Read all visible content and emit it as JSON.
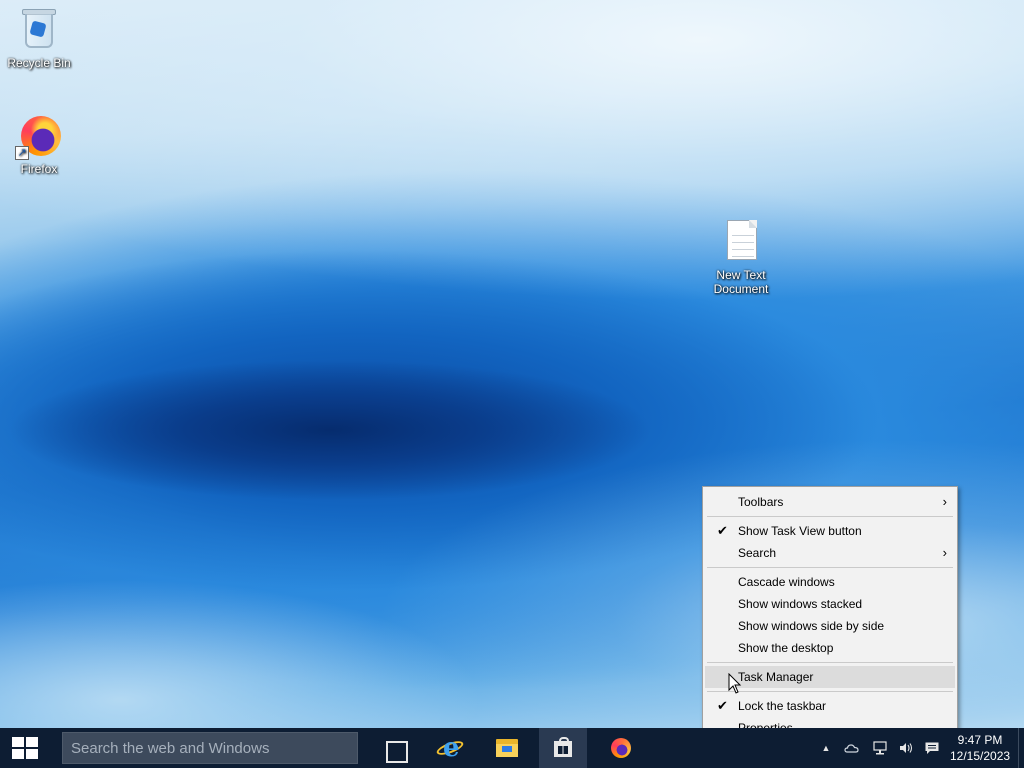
{
  "desktop": {
    "icons": [
      {
        "label": "Recycle Bin",
        "icon": "recycle-bin-icon"
      },
      {
        "label": "Firefox",
        "icon": "firefox-icon"
      },
      {
        "label": "New Text Document",
        "icon": "text-document-icon"
      }
    ]
  },
  "context_menu": {
    "items": [
      {
        "label": "Toolbars",
        "submenu": true
      },
      {
        "label": "Show Task View button",
        "checked": true
      },
      {
        "label": "Search",
        "submenu": true
      },
      {
        "label": "Cascade windows"
      },
      {
        "label": "Show windows stacked"
      },
      {
        "label": "Show windows side by side"
      },
      {
        "label": "Show the desktop"
      },
      {
        "label": "Task Manager",
        "hovered": true
      },
      {
        "label": "Lock the taskbar",
        "checked": true
      },
      {
        "label": "Properties"
      }
    ],
    "check_glyph": "✔",
    "arrow_glyph": "›"
  },
  "taskbar": {
    "search_placeholder": "Search the web and Windows",
    "apps": [
      {
        "name": "task-view",
        "icon": "task-view-icon"
      },
      {
        "name": "internet-explorer",
        "icon": "internet-explorer-icon"
      },
      {
        "name": "file-explorer",
        "icon": "file-explorer-icon"
      },
      {
        "name": "store",
        "icon": "store-icon",
        "active": true
      },
      {
        "name": "firefox",
        "icon": "firefox-icon"
      }
    ],
    "tray": {
      "overflow_glyph": "▲",
      "icons": [
        "onedrive-icon",
        "network-icon",
        "volume-icon",
        "action-center-icon"
      ]
    },
    "clock": {
      "time": "9:47 PM",
      "date": "12/15/2023"
    }
  },
  "colors": {
    "taskbar": "#0d1d33",
    "menu_bg": "#f2f2f2",
    "menu_hover": "#dcdcdc",
    "wallpaper_blue": "#1f78c8"
  }
}
